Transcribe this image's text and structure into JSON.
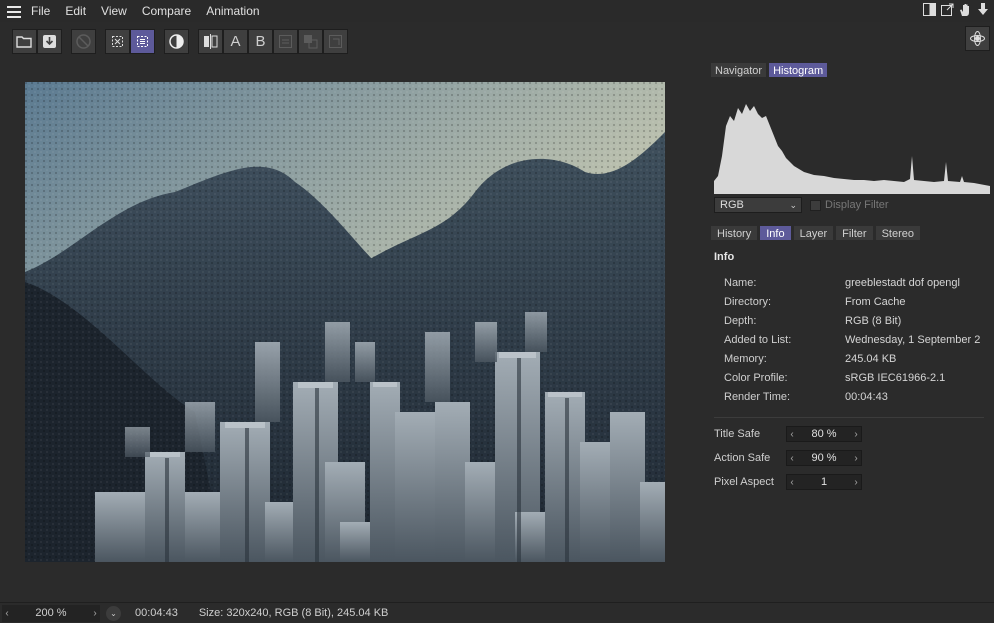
{
  "menu": {
    "items": [
      "File",
      "Edit",
      "View",
      "Compare",
      "Animation"
    ]
  },
  "toolbar": {
    "icons": [
      "open-folder-icon",
      "save-icon",
      "stop-icon",
      "region-render-icon",
      "interactive-render-icon",
      "display-filter-icon",
      "ab-compare-icon",
      "a-icon",
      "b-icon",
      "swap-icon",
      "difference-icon",
      "overlay-icon",
      "settings-icon"
    ],
    "a_label": "A",
    "b_label": "B"
  },
  "panel": {
    "top_tabs": [
      "Navigator",
      "Histogram"
    ],
    "active_top_tab": "Histogram",
    "channel_select": "RGB",
    "display_filter_label": "Display Filter",
    "info_tabs": [
      "History",
      "Info",
      "Layer",
      "Filter",
      "Stereo"
    ],
    "active_info_tab": "Info",
    "info_title": "Info",
    "info": [
      {
        "key": "Name:",
        "value": "greeblestadt dof opengl"
      },
      {
        "key": "Directory:",
        "value": "From Cache"
      },
      {
        "key": "Depth:",
        "value": "RGB (8 Bit)"
      },
      {
        "key": "Added to List:",
        "value": "Wednesday, 1 September 2"
      },
      {
        "key": "Memory:",
        "value": "245.04 KB"
      },
      {
        "key": "Color Profile:",
        "value": "sRGB IEC61966-2.1"
      },
      {
        "key": "Render Time:",
        "value": "00:04:43"
      }
    ],
    "settings": [
      {
        "key": "Title Safe",
        "value": "80 %"
      },
      {
        "key": "Action Safe",
        "value": "90 %"
      },
      {
        "key": "Pixel Aspect",
        "value": "1"
      }
    ]
  },
  "status": {
    "zoom": "200 %",
    "time": "00:04:43",
    "size": "Size: 320x240, RGB (8 Bit), 245.04 KB"
  },
  "colors": {
    "accent": "#5d5a9a",
    "background": "#2b2b2b"
  }
}
